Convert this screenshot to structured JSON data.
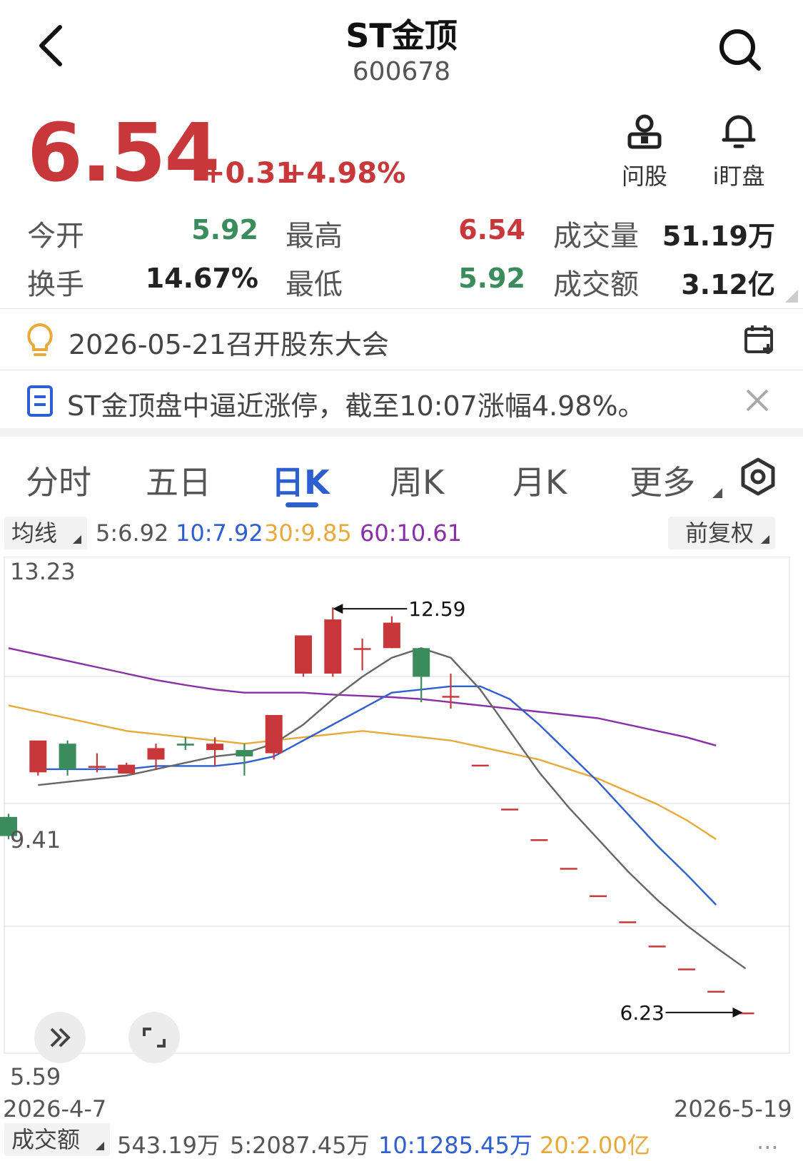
{
  "header": {
    "title": "ST金顶",
    "code": "600678",
    "back_icon": "chevron-left-icon",
    "search_icon": "search-icon"
  },
  "quote": {
    "price": "6.54",
    "change": "+0.31",
    "change_pct": "+4.98%",
    "up_color": "#c8383a",
    "down_color": "#3a8c5c"
  },
  "actions": [
    {
      "label": "问股",
      "icon": "user-icon"
    },
    {
      "label": "i盯盘",
      "icon": "bell-icon"
    }
  ],
  "stats": {
    "open_label": "今开",
    "open": "5.92",
    "high_label": "最高",
    "high": "6.54",
    "volume_label": "成交量",
    "volume": "51.19万",
    "turnover_label": "换手",
    "turnover": "14.67%",
    "low_label": "最低",
    "low": "5.92",
    "amount_label": "成交额",
    "amount": "3.12亿"
  },
  "notices": {
    "event": "2026-05-21召开股东大会",
    "news": "ST金顶盘中逼近涨停，截至10:07涨幅4.98%。"
  },
  "tabs": [
    "分时",
    "五日",
    "日K",
    "周K",
    "月K",
    "更多"
  ],
  "active_tab": "日K",
  "ma_legend": {
    "selector": "均线",
    "ma5": "5:6.92",
    "ma10": "10:7.92",
    "ma30": "30:9.85",
    "ma60": "60:10.61",
    "adjust": "前复权",
    "colors": {
      "ma5": "#666666",
      "ma10": "#2e5fd0",
      "ma30": "#e8a93a",
      "ma60": "#8a2ea8"
    }
  },
  "chart_data": {
    "type": "candlestick",
    "y_labels": [
      "13.23",
      "9.41",
      "5.59"
    ],
    "ylim": [
      5.59,
      13.23
    ],
    "x_start_label": "2026-4-7",
    "x_end_label": "2026-5-19",
    "max_annotation": "12.59",
    "min_annotation": "6.23",
    "candles": [
      {
        "o": 9.3,
        "h": 9.35,
        "c": 9.0,
        "l": 8.95
      },
      {
        "o": 10.0,
        "h": 10.3,
        "c": 10.5,
        "l": 9.95
      },
      {
        "o": 10.45,
        "h": 10.5,
        "c": 10.05,
        "l": 9.95
      },
      {
        "o": 10.07,
        "h": 10.3,
        "c": 10.1,
        "l": 10.0
      },
      {
        "o": 9.98,
        "h": 10.15,
        "c": 10.12,
        "l": 9.98
      },
      {
        "o": 10.2,
        "h": 10.45,
        "c": 10.38,
        "l": 10.05
      },
      {
        "o": 10.45,
        "h": 10.55,
        "c": 10.42,
        "l": 10.35
      },
      {
        "o": 10.35,
        "h": 10.55,
        "c": 10.45,
        "l": 10.1
      },
      {
        "o": 10.35,
        "h": 10.45,
        "c": 10.25,
        "l": 9.95
      },
      {
        "o": 10.3,
        "h": 10.8,
        "c": 10.9,
        "l": 10.2
      },
      {
        "o": 11.55,
        "h": 11.55,
        "c": 12.15,
        "l": 11.5
      },
      {
        "o": 11.55,
        "h": 12.59,
        "c": 12.4,
        "l": 11.5
      },
      {
        "o": 11.95,
        "h": 12.1,
        "c": 11.95,
        "l": 11.6
      },
      {
        "o": 11.95,
        "h": 12.45,
        "c": 12.35,
        "l": 11.95
      },
      {
        "o": 11.95,
        "h": 11.95,
        "c": 11.5,
        "l": 11.1
      },
      {
        "o": 11.2,
        "h": 11.55,
        "c": 11.2,
        "l": 11.0
      },
      {
        "o": 10.12,
        "h": 10.12,
        "c": 10.12,
        "l": 10.12
      },
      {
        "o": 9.43,
        "h": 9.43,
        "c": 9.43,
        "l": 9.43
      },
      {
        "o": 8.95,
        "h": 8.95,
        "c": 8.95,
        "l": 8.95
      },
      {
        "o": 8.5,
        "h": 8.5,
        "c": 8.5,
        "l": 8.5
      },
      {
        "o": 8.07,
        "h": 8.07,
        "c": 8.07,
        "l": 8.07
      },
      {
        "o": 7.66,
        "h": 7.66,
        "c": 7.66,
        "l": 7.66
      },
      {
        "o": 7.28,
        "h": 7.28,
        "c": 7.28,
        "l": 7.28
      },
      {
        "o": 6.92,
        "h": 6.92,
        "c": 6.92,
        "l": 6.92
      },
      {
        "o": 6.57,
        "h": 6.57,
        "c": 6.57,
        "l": 6.57
      },
      {
        "o": 6.23,
        "h": 6.23,
        "c": 6.23,
        "l": 6.23
      }
    ],
    "ma5": [
      9.8,
      9.85,
      9.9,
      9.95,
      10.05,
      10.15,
      10.25,
      10.3,
      10.45,
      10.75,
      11.15,
      11.5,
      11.8,
      11.95,
      11.8,
      11.3,
      10.65,
      10.0,
      9.45,
      8.95,
      8.45,
      8.0,
      7.6,
      7.25,
      6.92
    ],
    "ma10": [
      10.05,
      10.05,
      10.05,
      10.05,
      10.1,
      10.1,
      10.1,
      10.15,
      10.25,
      10.5,
      10.75,
      11.0,
      11.25,
      11.3,
      11.35,
      11.35,
      11.15,
      10.75,
      10.3,
      9.85,
      9.35,
      8.85,
      8.4,
      7.92
    ],
    "ma30": [
      11.05,
      10.95,
      10.85,
      10.75,
      10.65,
      10.6,
      10.55,
      10.5,
      10.45,
      10.5,
      10.55,
      10.6,
      10.65,
      10.6,
      10.55,
      10.5,
      10.4,
      10.3,
      10.2,
      10.05,
      9.9,
      9.7,
      9.5,
      9.25,
      8.95
    ],
    "ma60": [
      11.95,
      11.85,
      11.75,
      11.65,
      11.55,
      11.45,
      11.37,
      11.3,
      11.25,
      11.25,
      11.25,
      11.22,
      11.2,
      11.18,
      11.15,
      11.1,
      11.05,
      11.0,
      10.95,
      10.9,
      10.85,
      10.75,
      10.65,
      10.55,
      10.42
    ]
  },
  "volume_legend": {
    "selector": "成交额",
    "current": "543.19万",
    "ma5": "5:2087.45万",
    "ma10": "10:1285.45万",
    "ma20": "20:2.00亿"
  },
  "info_tail": "..."
}
